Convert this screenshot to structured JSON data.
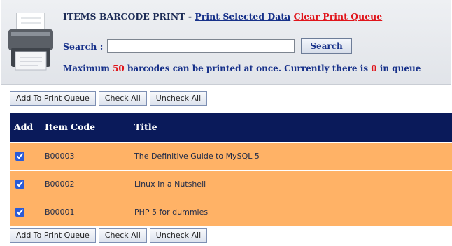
{
  "header": {
    "title": "ITEMS BARCODE PRINT",
    "separator": " - ",
    "print_selected_label": "Print Selected Data",
    "clear_queue_label": "Clear Print Queue",
    "search_label": "Search :",
    "search_value": "",
    "search_button_label": "Search",
    "info": {
      "prefix": "Maximum ",
      "max_count": "50",
      "middle": " barcodes can be printed at once. Currently there is ",
      "queue_count": "0",
      "suffix": " in queue"
    }
  },
  "actions": {
    "add_to_queue_label": "Add To Print Queue",
    "check_all_label": "Check All",
    "uncheck_all_label": "Uncheck All"
  },
  "table": {
    "columns": {
      "add": "Add",
      "item_code": "Item Code",
      "title": "Title"
    },
    "rows": [
      {
        "checked": true,
        "item_code": "B00003",
        "title": "The Definitive Guide to MySQL 5"
      },
      {
        "checked": true,
        "item_code": "B00002",
        "title": "Linux In a Nutshell"
      },
      {
        "checked": true,
        "item_code": "B00001",
        "title": "PHP 5 for dummies"
      }
    ]
  },
  "colors": {
    "header_bg": "#e1e4e9",
    "table_header_bg": "#0a1a5a",
    "row_bg": "#ffb266",
    "accent_red": "#e0141b",
    "link_blue": "#17318a"
  },
  "icons": {
    "header_logo": "printer-icon"
  }
}
